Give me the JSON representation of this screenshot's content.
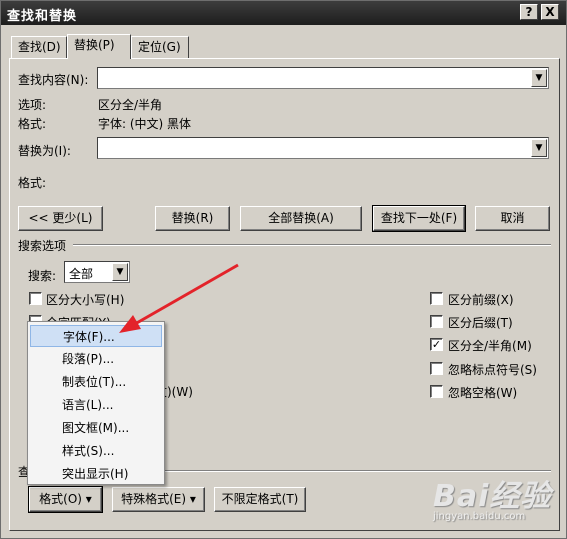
{
  "window": {
    "title": "查找和替换",
    "help_btn": "?",
    "close_btn": "X"
  },
  "tabs": [
    {
      "label": "查找(D)"
    },
    {
      "label": "替换(P)"
    },
    {
      "label": "定位(G)"
    }
  ],
  "find": {
    "label": "查找内容(N):",
    "value": "",
    "options_label": "选项:",
    "options_value": "区分全/半角",
    "format_label": "格式:",
    "format_value": "字体: (中文) 黑体"
  },
  "replace": {
    "label": "替换为(I):",
    "value": "",
    "format_label": "格式:",
    "format_value": ""
  },
  "buttons": {
    "less": "<< 更少(L)",
    "replace": "替换(R)",
    "replace_all": "全部替换(A)",
    "find_next": "查找下一处(F)",
    "cancel": "取消"
  },
  "search_options": {
    "section_label": "搜索选项",
    "search_label": "搜索:",
    "search_value": "全部",
    "left": [
      {
        "label": "区分大小写(H)",
        "checked": false
      },
      {
        "label": "全字匹配(Y)",
        "checked": false
      },
      {
        "label": "文)(W)",
        "checked": false
      }
    ],
    "right": [
      {
        "label": "区分前缀(X)",
        "checked": false
      },
      {
        "label": "区分后缀(T)",
        "checked": false
      },
      {
        "label": "区分全/半角(M)",
        "checked": true
      },
      {
        "label": "忽略标点符号(S)",
        "checked": false
      },
      {
        "label": "忽略空格(W)",
        "checked": false
      }
    ]
  },
  "replace_section": {
    "label_fragment": "查"
  },
  "bottom_buttons": {
    "format": "格式(O) ▾",
    "special": "特殊格式(E) ▾",
    "no_format": "不限定格式(T)"
  },
  "format_menu": [
    {
      "label": "字体(F)..."
    },
    {
      "label": "段落(P)..."
    },
    {
      "label": "制表位(T)..."
    },
    {
      "label": "语言(L)..."
    },
    {
      "label": "图文框(M)..."
    },
    {
      "label": "样式(S)..."
    },
    {
      "label": "突出显示(H)"
    }
  ],
  "watermark": {
    "brand": "Bai经验",
    "url": "jingyan.baidu.com"
  },
  "colors": {
    "arrow": "#e3232a",
    "menu_highlight": "#cfe0f5",
    "dialog_bg": "#d4d0c8"
  }
}
